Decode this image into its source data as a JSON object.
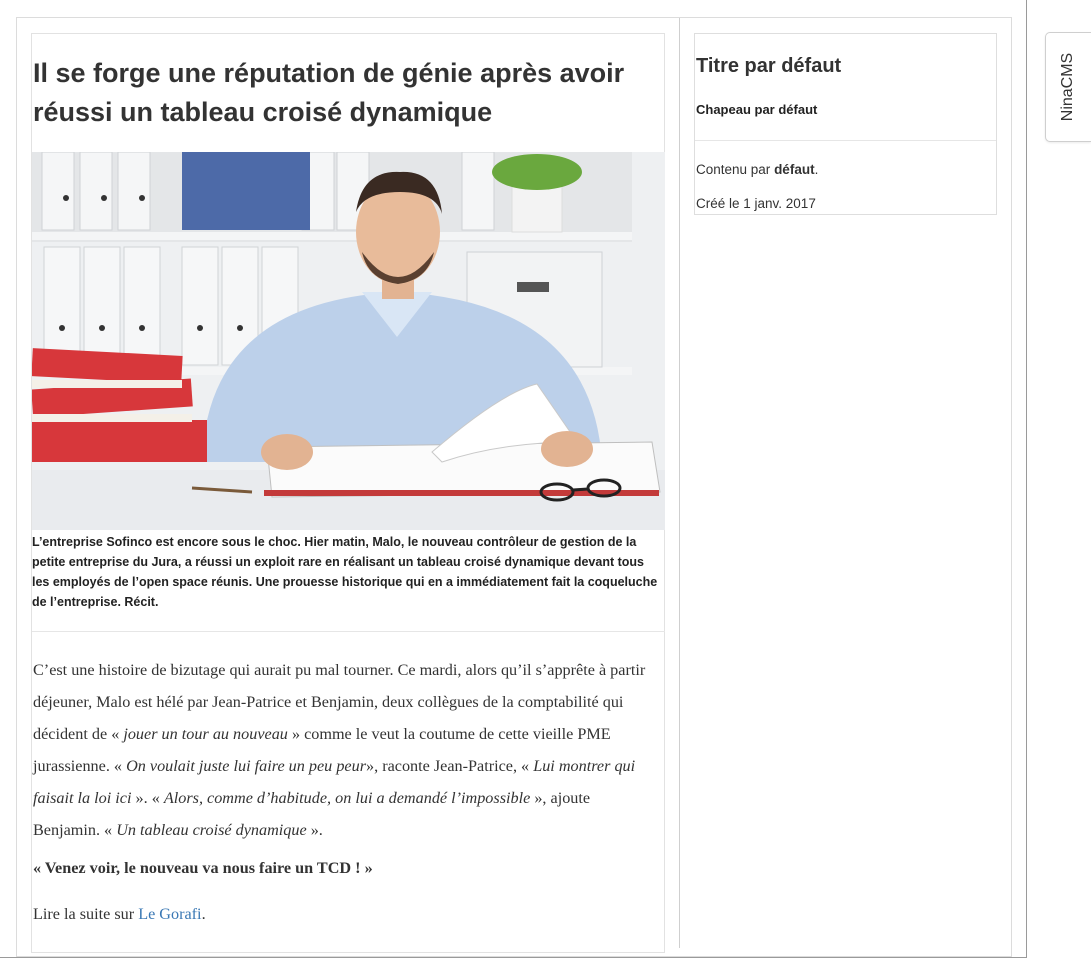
{
  "article": {
    "title": "Il se forge une réputation de génie après avoir réussi un tableau croisé dynamique",
    "lead": "L’entreprise Sofinco est encore sous le choc. Hier matin, Malo, le nouveau contrôleur de gestion de la petite entreprise du Jura, a réussi un exploit rare en réalisant un tableau croisé dynamique devant tous les employés de l’open space réunis. Une prouesse historique qui en a immédiatement fait la coqueluche de l’entreprise. Récit.",
    "body": {
      "p1_a": "C’est une histoire de bizutage qui aurait pu mal tourner. Ce mardi, alors qu’il s’apprête à partir déjeuner, Malo est hélé par Jean-Patrice et Benjamin, deux collègues de la comptabilité qui décident de « ",
      "p1_i1": "jouer un tour au nouveau",
      "p1_b": " » comme le veut la coutume de cette vieille PME jurassienne. « ",
      "p1_i2": "On voulait juste lui faire un peu peur",
      "p1_c": "», raconte Jean-Patrice, « ",
      "p1_i3": "Lui montrer qui faisait la loi ici",
      "p1_d": " ». « ",
      "p1_i4": "Alors, comme d’habitude, on lui a demandé l’impossible",
      "p1_e": " », ajoute Benjamin. « ",
      "p1_i5": "Un tableau croisé dynamique",
      "p1_f": " ».",
      "quote": "« Venez voir, le nouveau va nous faire un TCD ! »",
      "more_prefix": "Lire la suite sur ",
      "more_link": "Le Gorafi",
      "more_suffix": "."
    }
  },
  "sidebar": {
    "title": "Titre par défaut",
    "chapeau": "Chapeau par défaut",
    "content_prefix": "Contenu par ",
    "content_bold": "défaut",
    "content_suffix": ".",
    "created": "Créé le 1 janv. 2017"
  },
  "cms_tab": {
    "label": "NinaCMS"
  },
  "colors": {
    "link": "#3a78b4",
    "text": "#333333",
    "border": "#dddddd"
  }
}
